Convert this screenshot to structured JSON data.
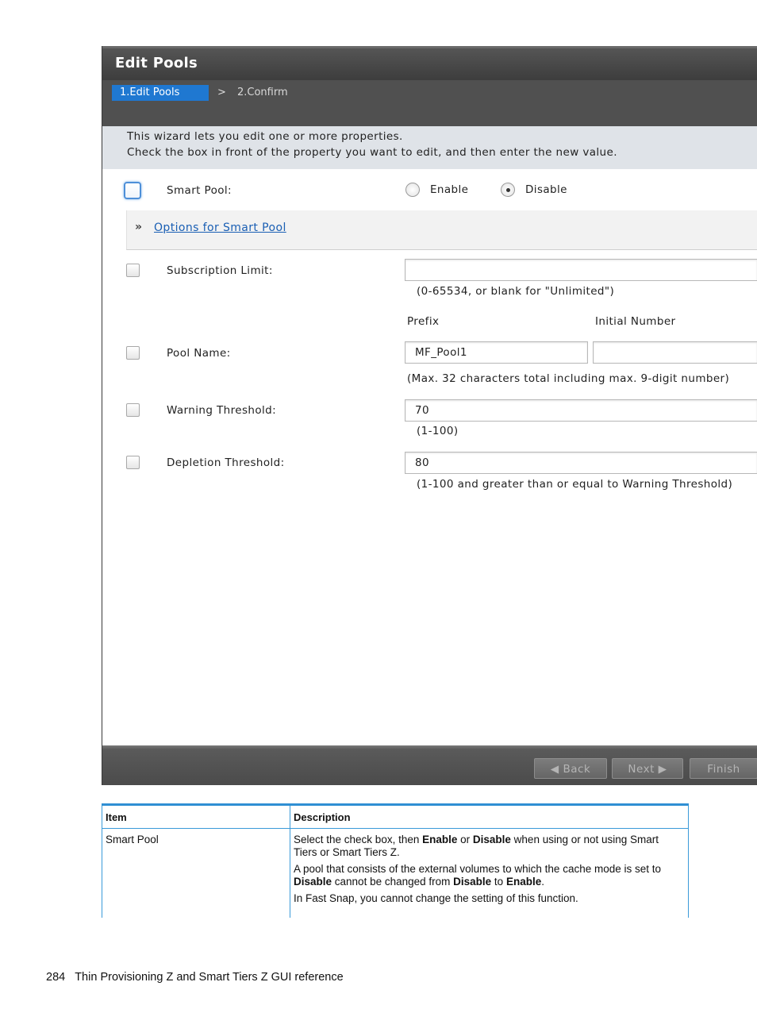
{
  "dialog": {
    "title": "Edit Pools",
    "steps": {
      "active": "1.Edit Pools",
      "separator": ">",
      "next": "2.Confirm"
    },
    "instructions": [
      "This wizard lets you edit one or more properties.",
      "Check the  box in front of the property you want to edit, and then enter the new value."
    ],
    "smart_pool": {
      "label": "Smart Pool:",
      "enable": "Enable",
      "disable": "Disable",
      "selected": "Disable"
    },
    "options_link": "Options for Smart Pool",
    "subscription": {
      "label": "Subscription Limit:",
      "value": "",
      "hint": "(0-65534, or blank for \"Unlimited\")"
    },
    "pool_name": {
      "label": "Pool Name:",
      "prefix_header": "Prefix",
      "initial_header": "Initial Number",
      "prefix_value": "MF_Pool1",
      "initial_value": "",
      "hint": "(Max. 32 characters total including max. 9-digit number)"
    },
    "warning": {
      "label": "Warning Threshold:",
      "value": "70",
      "hint": "(1-100)"
    },
    "depletion": {
      "label": "Depletion Threshold:",
      "value": "80",
      "hint": "(1-100 and greater than or equal to Warning Threshold)"
    },
    "buttons": {
      "back": "Back",
      "next": "Next",
      "finish": "Finish"
    }
  },
  "table": {
    "headers": [
      "Item",
      "Description"
    ],
    "row": {
      "item": "Smart Pool",
      "p1": [
        "Select the check box, then ",
        "Enable",
        " or ",
        "Disable",
        " when using or not using Smart Tiers or Smart Tiers Z."
      ],
      "p2": [
        "A pool that consists of the external volumes to which the cache mode is set to ",
        "Disable",
        " cannot be changed from ",
        "Disable",
        " to ",
        "Enable",
        "."
      ],
      "p3": "In Fast Snap, you cannot change the setting of this function."
    }
  },
  "footer": {
    "page_number": "284",
    "text": "Thin Provisioning Z and Smart Tiers Z GUI reference"
  }
}
